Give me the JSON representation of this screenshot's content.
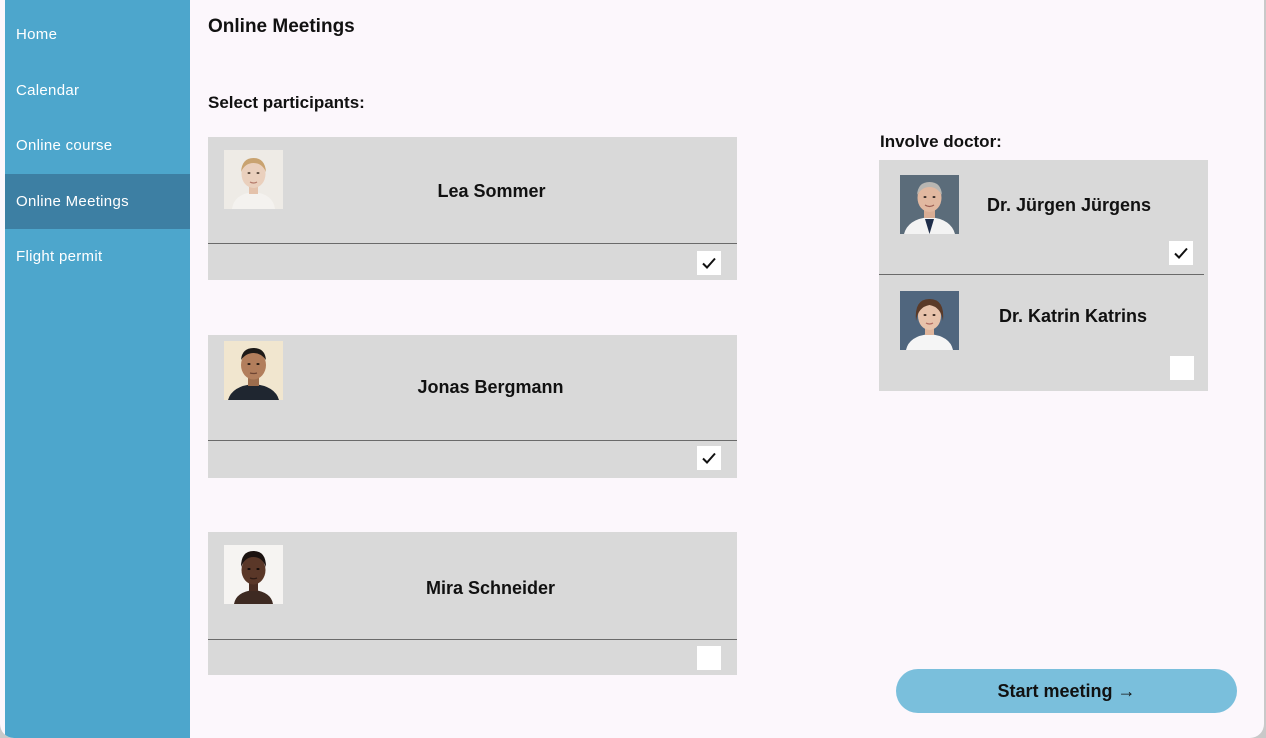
{
  "sidebar": {
    "items": [
      {
        "label": "Home"
      },
      {
        "label": "Calendar"
      },
      {
        "label": "Online course"
      },
      {
        "label": "Online Meetings",
        "active": true
      },
      {
        "label": "Flight permit"
      }
    ]
  },
  "main": {
    "title": "Online Meetings",
    "participants_label": "Select participants:",
    "doctors_label": "Involve doctor:",
    "participants": [
      {
        "name": "Lea Sommer",
        "checked": true
      },
      {
        "name": "Jonas Bergmann",
        "checked": true
      },
      {
        "name": "Mira Schneider",
        "checked": false
      }
    ],
    "doctors": [
      {
        "name": "Dr. Jürgen Jürgens",
        "checked": true
      },
      {
        "name": "Dr. Katrin Katrins",
        "checked": false
      }
    ],
    "start_button": "Start meeting →"
  },
  "colors": {
    "sidebar": "#4da6cc",
    "sidebar_active": "#3d7fa3",
    "card": "#d9d9d9",
    "button": "#7abfdc",
    "page_bg": "#fcf7fc"
  }
}
